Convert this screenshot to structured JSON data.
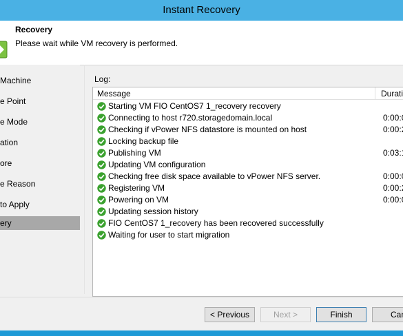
{
  "window": {
    "title": "Instant Recovery"
  },
  "header": {
    "title": "Recovery",
    "subtitle": "Please wait while VM recovery is performed."
  },
  "sidebar": {
    "items": [
      {
        "label": "Machine"
      },
      {
        "label": "e Point"
      },
      {
        "label": "e Mode"
      },
      {
        "label": "ation"
      },
      {
        "label": "ore"
      },
      {
        "label": "e Reason"
      },
      {
        "label": "to Apply"
      },
      {
        "label": "ery",
        "active": true
      }
    ]
  },
  "log": {
    "label": "Log:",
    "columns": {
      "message": "Message",
      "duration": "Duratio"
    },
    "rows": [
      {
        "status_icon": "check-icon",
        "message": "Starting VM FIO CentOS7 1_recovery recovery",
        "duration": ""
      },
      {
        "status_icon": "check-icon",
        "message": "Connecting to host r720.storagedomain.local",
        "duration": "0:00:0"
      },
      {
        "status_icon": "check-icon",
        "message": "Checking if vPower NFS datastore is mounted on host",
        "duration": "0:00:2"
      },
      {
        "status_icon": "check-icon",
        "message": "Locking backup file",
        "duration": ""
      },
      {
        "status_icon": "check-icon",
        "message": "Publishing VM",
        "duration": "0:03:1"
      },
      {
        "status_icon": "check-icon",
        "message": "Updating VM configuration",
        "duration": ""
      },
      {
        "status_icon": "check-icon",
        "message": "Checking free disk space available to vPower NFS server.",
        "duration": "0:00:0"
      },
      {
        "status_icon": "check-icon",
        "message": "Registering VM",
        "duration": "0:00:2"
      },
      {
        "status_icon": "check-icon",
        "message": "Powering on VM",
        "duration": "0:00:0"
      },
      {
        "status_icon": "check-icon",
        "message": "Updating session history",
        "duration": ""
      },
      {
        "status_icon": "check-icon",
        "message": "FIO CentOS7 1_recovery has been recovered successfully",
        "duration": ""
      },
      {
        "status_icon": "check-icon",
        "message": "Waiting for user to start migration",
        "duration": ""
      }
    ]
  },
  "buttons": {
    "previous": "< Previous",
    "next": "Next >",
    "finish": "Finish",
    "cancel": "Cance"
  },
  "colors": {
    "titlebar": "#4ab1e4",
    "frame": "#1e9ad6",
    "success": "#3aa12e",
    "active_step": "#a8a8a8"
  }
}
